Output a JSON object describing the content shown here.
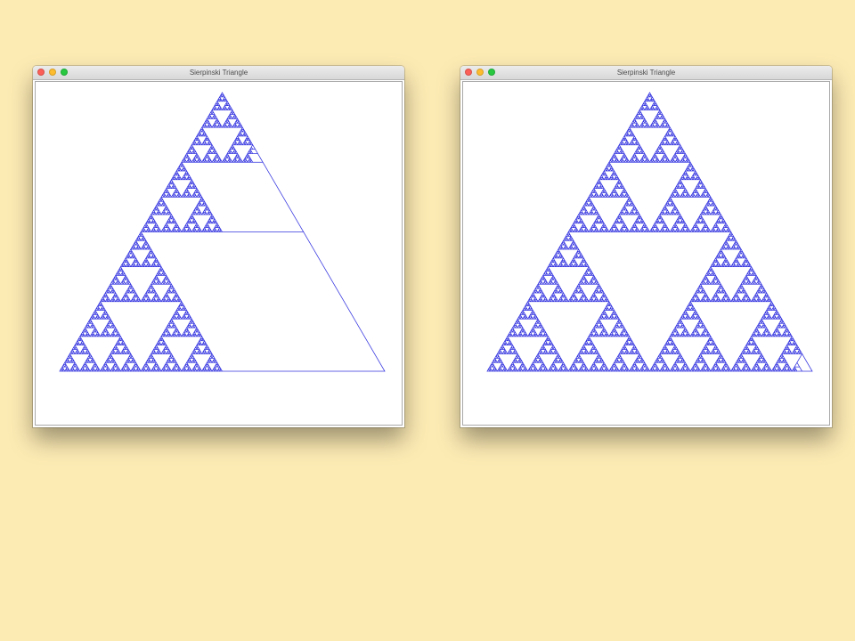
{
  "windows": [
    {
      "title": "Sierpinski Triangle",
      "fractal": {
        "depth": 7,
        "render_progress_percent": 55,
        "stroke_color": "#3434e0"
      }
    },
    {
      "title": "Sierpinski Triangle",
      "fractal": {
        "depth": 7,
        "render_progress_percent": 99,
        "stroke_color": "#3434e0"
      }
    }
  ],
  "colors": {
    "desktop_background": "#fdebb4",
    "close_button": "#fc5f57",
    "minimize_button": "#fdbc2e",
    "zoom_button": "#28c840"
  },
  "icons": [
    "close-button-icon",
    "minimize-button-icon",
    "zoom-button-icon"
  ]
}
